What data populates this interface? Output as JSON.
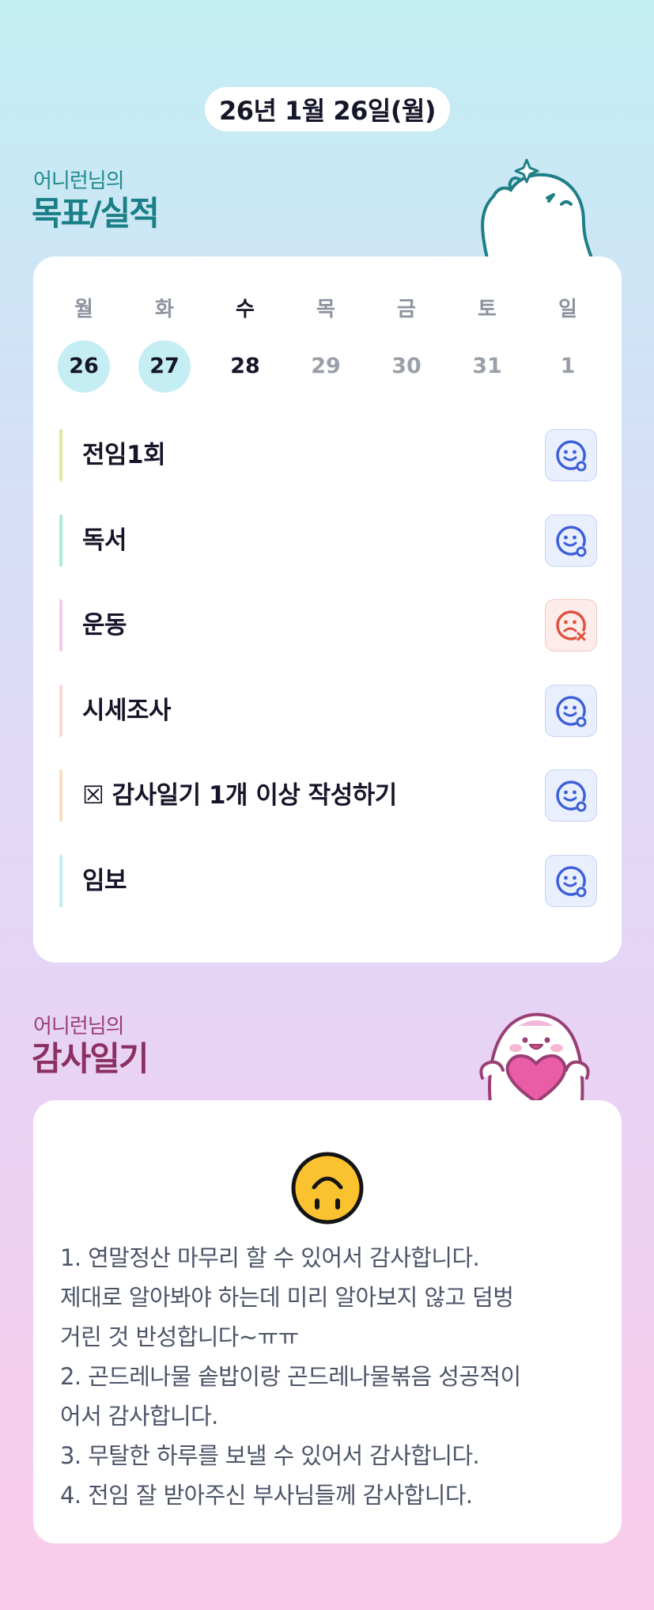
{
  "date": "26년 1월 26일(월)",
  "goals_section": {
    "subtitle": "어니런님의",
    "title": "목표/실적"
  },
  "week": {
    "days": [
      {
        "name": "월",
        "num": "26",
        "state": "done"
      },
      {
        "name": "화",
        "num": "27",
        "state": "done"
      },
      {
        "name": "수",
        "num": "28",
        "state": "today"
      },
      {
        "name": "목",
        "num": "29",
        "state": "future"
      },
      {
        "name": "금",
        "num": "30",
        "state": "future"
      },
      {
        "name": "토",
        "num": "31",
        "state": "future"
      },
      {
        "name": "일",
        "num": "1",
        "state": "future"
      }
    ]
  },
  "goals": [
    {
      "label": "전임1회",
      "bar_color": "#d8ee9c",
      "status": "achieved",
      "icon": "smile-o-icon"
    },
    {
      "label": "독서",
      "bar_color": "#a9edd9",
      "status": "achieved",
      "icon": "smile-o-icon"
    },
    {
      "label": "운동",
      "bar_color": "#f7c8ee",
      "status": "failed",
      "icon": "sad-x-icon"
    },
    {
      "label": "시세조사",
      "bar_color": "#fbd7d5",
      "status": "achieved",
      "icon": "smile-o-icon"
    },
    {
      "label": "☒ 감사일기 1개 이상 작성하기",
      "bar_color": "#fddcc0",
      "status": "achieved",
      "icon": "smile-o-icon"
    },
    {
      "label": "임보",
      "bar_color": "#bdeef2",
      "status": "achieved",
      "icon": "smile-o-icon"
    }
  ],
  "diary_section": {
    "subtitle": "어니런님의",
    "title": "감사일기",
    "mood_icon": "upside-down-face-icon",
    "lines": [
      "1. 연말정산 마무리 할 수 있어서 감사합니다.",
      "제대로 알아봐야 하는데 미리 알아보지 않고 덤벙",
      "거린 것 반성합니다~ㅠㅠ",
      "2. 곤드레나물 솥밥이랑 곤드레나물볶음 성공적이",
      "어서 감사합니다.",
      "3. 무탈한 하루를 보낼 수 있어서 감사합니다.",
      "4. 전임 잘 받아주신 부사님들께 감사합니다."
    ]
  },
  "colors": {
    "ok_icon": "#3b5fd8",
    "fail_icon": "#e0503f",
    "done_day_bg": "#c4eef3",
    "goals_title": "#1a7f86",
    "diary_title": "#8c2f63"
  }
}
